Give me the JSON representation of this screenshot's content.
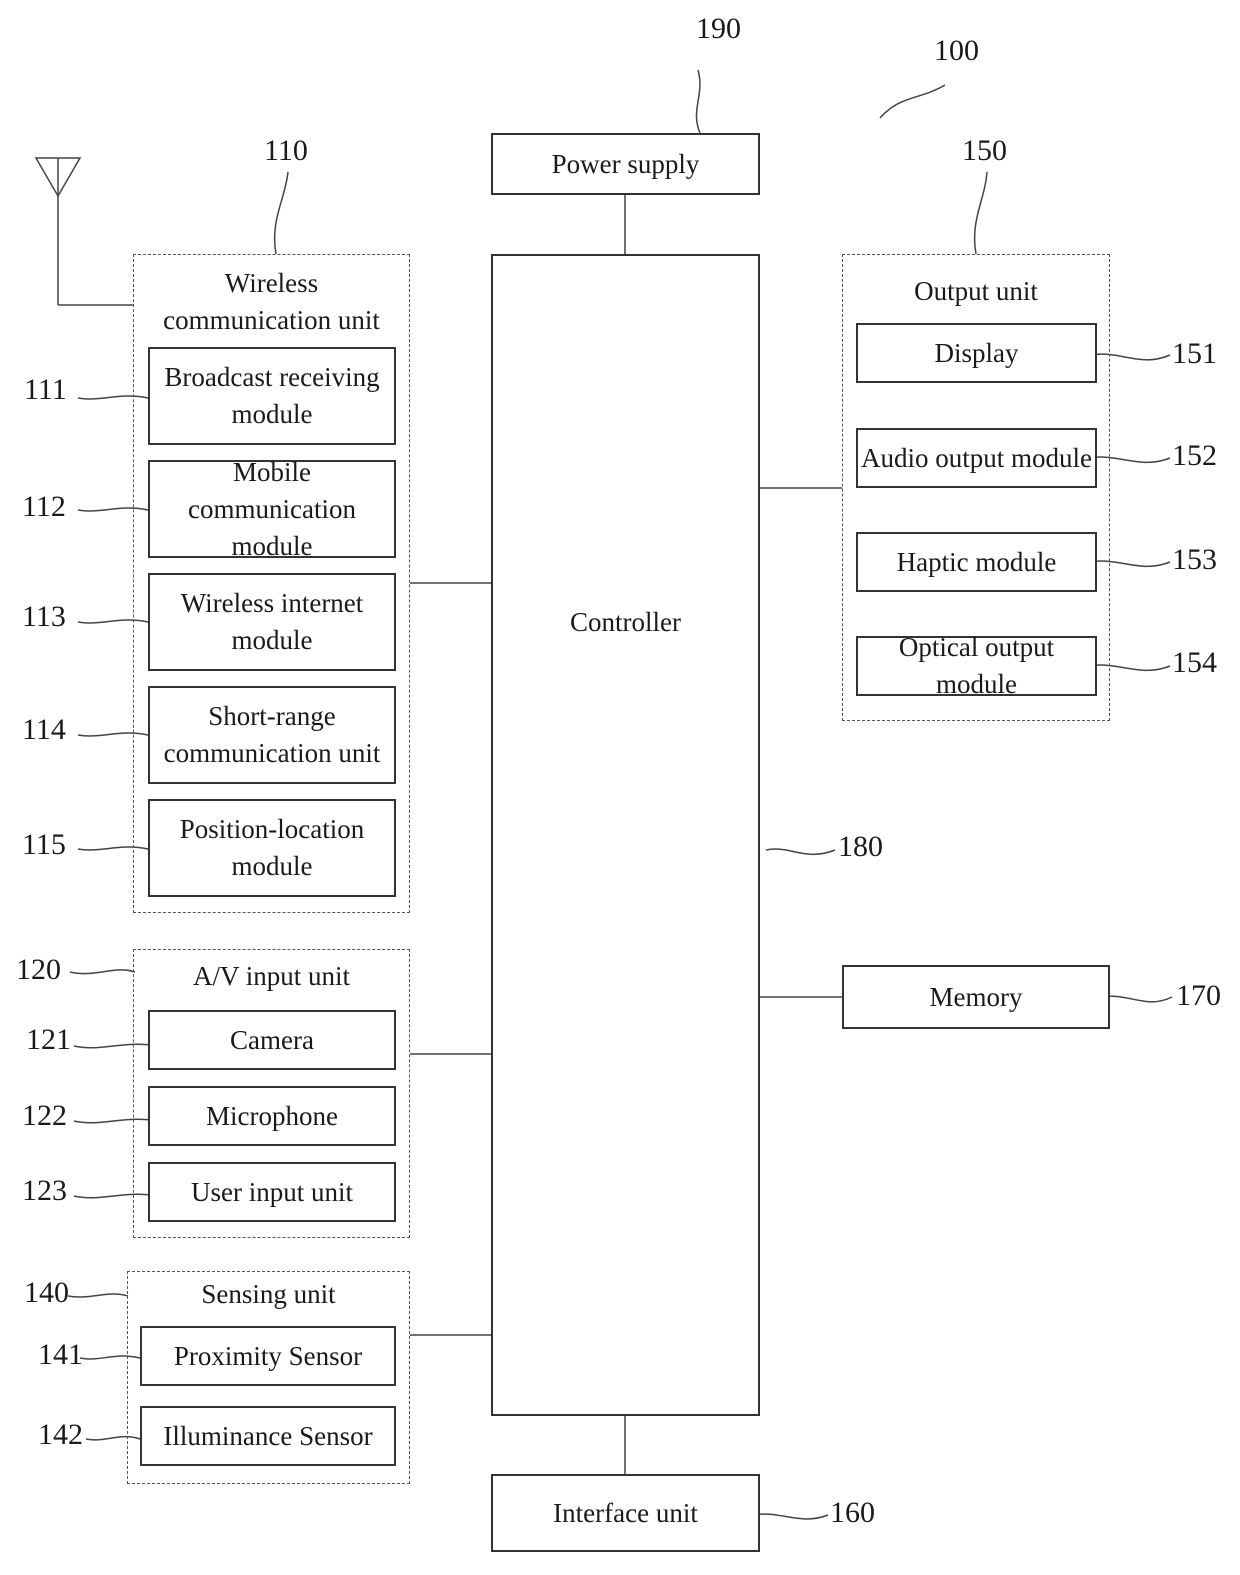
{
  "figure_ref": "100",
  "power_supply": {
    "ref": "190",
    "label": "Power supply"
  },
  "controller": {
    "ref": "180",
    "label": "Controller"
  },
  "interface_unit": {
    "ref": "160",
    "label": "Interface unit"
  },
  "memory": {
    "ref": "170",
    "label": "Memory"
  },
  "wireless_unit": {
    "ref": "110",
    "title_line1": "Wireless",
    "title_line2": "communication unit",
    "antenna_icon": "antenna-icon",
    "modules": [
      {
        "ref": "111",
        "line1": "Broadcast receiving",
        "line2": "module"
      },
      {
        "ref": "112",
        "line1": "Mobile communication",
        "line2": "module"
      },
      {
        "ref": "113",
        "line1": "Wireless internet",
        "line2": "module"
      },
      {
        "ref": "114",
        "line1": "Short-range",
        "line2": "communication unit"
      },
      {
        "ref": "115",
        "line1": "Position-location",
        "line2": "module"
      }
    ]
  },
  "av_unit": {
    "ref": "120",
    "title": "A/V input unit",
    "modules": [
      {
        "ref": "121",
        "label": "Camera"
      },
      {
        "ref": "122",
        "label": "Microphone"
      },
      {
        "ref": "123",
        "label": "User input unit"
      }
    ]
  },
  "sensing_unit": {
    "ref": "140",
    "title": "Sensing unit",
    "modules": [
      {
        "ref": "141",
        "label": "Proximity Sensor"
      },
      {
        "ref": "142",
        "label": "Illuminance Sensor"
      }
    ]
  },
  "output_unit": {
    "ref": "150",
    "title": "Output unit",
    "modules": [
      {
        "ref": "151",
        "label": "Display"
      },
      {
        "ref": "152",
        "label": "Audio output module"
      },
      {
        "ref": "153",
        "label": "Haptic module"
      },
      {
        "ref": "154",
        "label": "Optical output module"
      }
    ]
  }
}
